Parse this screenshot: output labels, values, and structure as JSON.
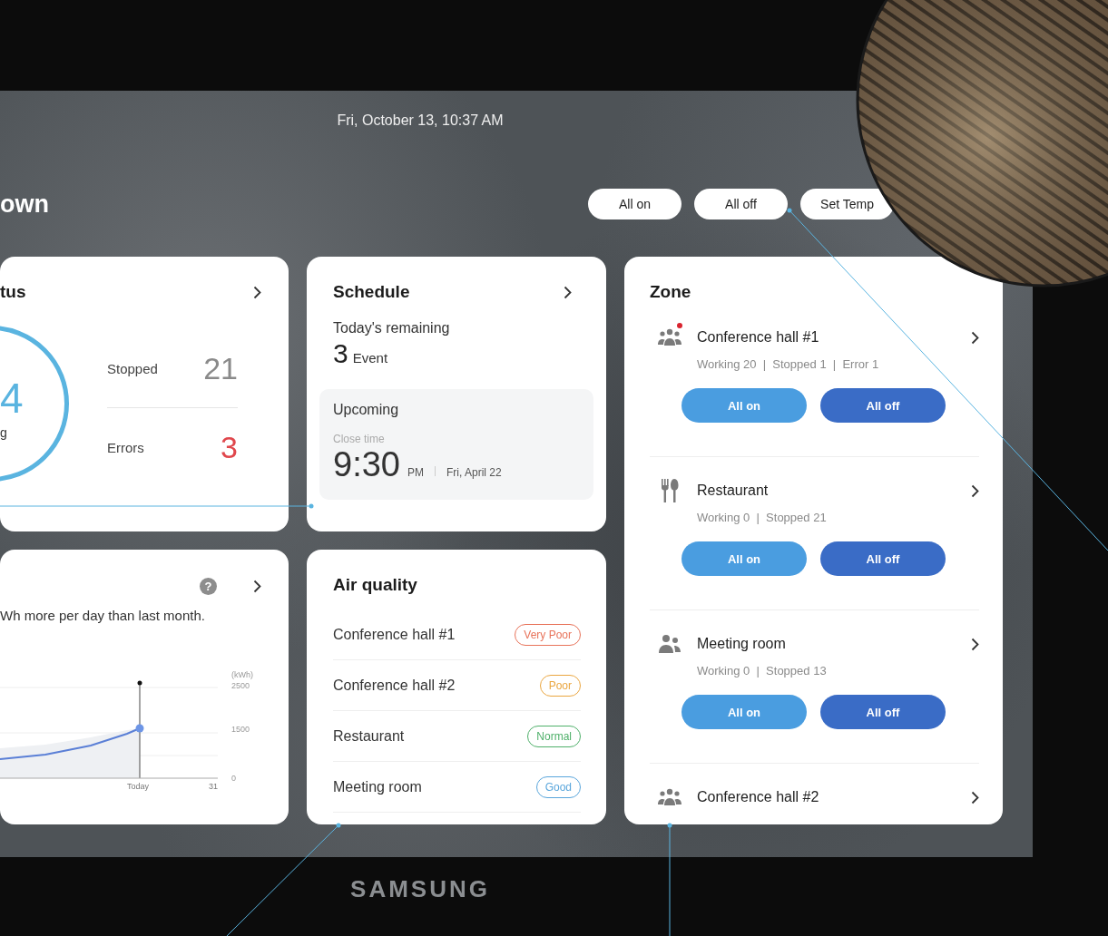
{
  "screen": {
    "datetime": "Fri, October 13, 10:37 AM",
    "title": "own",
    "actions": [
      "All on",
      "All off",
      "Set Temp"
    ]
  },
  "status_card": {
    "title": "tus",
    "ring": {
      "value": "4",
      "label": "g"
    },
    "stats": [
      {
        "label": "Stopped",
        "value": "21",
        "kind": "normal"
      },
      {
        "label": "Errors",
        "value": "3",
        "kind": "error"
      }
    ]
  },
  "energy_card": {
    "help": "?",
    "summary": "Wh more per day than last month.",
    "chart": {
      "unit": "(kWh)",
      "y_ticks": [
        "2500",
        "1500",
        "0"
      ],
      "x_labels": [
        "Today",
        "31"
      ]
    }
  },
  "schedule_card": {
    "title": "Schedule",
    "remaining_label": "Today's remaining",
    "remaining_count": "3",
    "remaining_unit": "Event",
    "upcoming": {
      "title": "Upcoming",
      "caption": "Close time",
      "time": "9:30",
      "meridiem": "PM",
      "date": "Fri, April 22"
    }
  },
  "air_quality": {
    "title": "Air quality",
    "rows": [
      {
        "place": "Conference hall #1",
        "rating": "Very Poor",
        "color": "#e8735a"
      },
      {
        "place": "Conference hall #2",
        "rating": "Poor",
        "color": "#eaa640"
      },
      {
        "place": "Restaurant",
        "rating": "Normal",
        "color": "#4fb06a"
      },
      {
        "place": "Meeting room",
        "rating": "Good",
        "color": "#5aa6dc"
      }
    ]
  },
  "zone": {
    "title": "Zone",
    "zones": [
      {
        "kind": "group",
        "name": "Conference hall #1",
        "alert": true,
        "stats": "Working 20  |  Stopped 1  |  Error 1",
        "buttons": [
          "All on",
          "All off"
        ]
      },
      {
        "kind": "dining",
        "name": "Restaurant",
        "alert": false,
        "stats": "Working 0  |  Stopped 21",
        "buttons": [
          "All on",
          "All off"
        ]
      },
      {
        "kind": "pair",
        "name": "Meeting room",
        "alert": false,
        "stats": "Working 0  |  Stopped 13",
        "buttons": [
          "All on",
          "All off"
        ]
      },
      {
        "kind": "group",
        "name": "Conference hall #2",
        "alert": false
      }
    ]
  },
  "device_brand": "SAMSUNG"
}
